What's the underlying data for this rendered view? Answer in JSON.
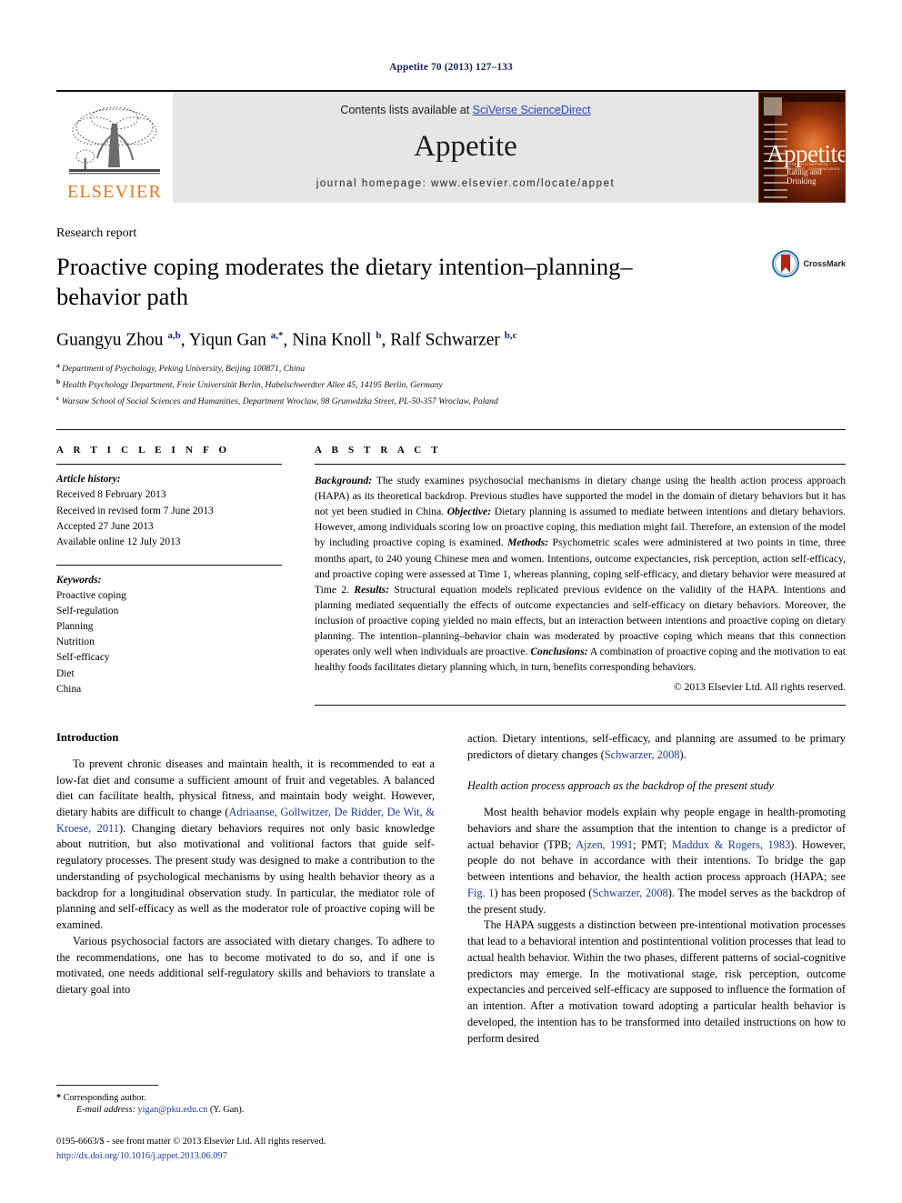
{
  "running_head": "Appetite 70 (2013) 127–133",
  "masthead": {
    "publisher_name": "ELSEVIER",
    "contents_prefix": "Contents lists available at ",
    "contents_link": "SciVerse ScienceDirect",
    "journal_name": "Appetite",
    "homepage_line": "journal homepage: www.elsevier.com/locate/appet",
    "cover": {
      "title": "Appetite",
      "subtitle_small": "RESEARCH REPORTS · REVIEWS · COMMENTARIES",
      "subtitle": "Eating and Drinking"
    },
    "link_color": "#2b46b4",
    "band_color": "#e6e6e6",
    "elsevier_orange": "#e87722"
  },
  "article": {
    "kicker": "Research report",
    "title": "Proactive coping moderates the dietary intention–planning–behavior path",
    "crossmark_label": "CrossMark",
    "authors_html": "Guangyu Zhou <sup>a,b</sup>, Yiqun Gan <sup>a,*</sup>, Nina Knoll <sup>b</sup>, Ralf Schwarzer <sup>b,c</sup>",
    "affiliations": [
      {
        "marker": "a",
        "text": "Department of Psychology, Peking University, Beijing 100871, China"
      },
      {
        "marker": "b",
        "text": "Health Psychology Department, Freie Universität Berlin, Habelschwerdter Allee 45, 14195 Berlin, Germany"
      },
      {
        "marker": "c",
        "text": "Warsaw School of Social Sciences and Humanities, Department Wroclaw, 98 Grunwdzka Street, PL-50-357 Wroclaw, Poland"
      }
    ]
  },
  "article_info": {
    "heading": "A R T I C L E   I N F O",
    "history_label": "Article history:",
    "history": [
      "Received 8 February 2013",
      "Received in revised form 7 June 2013",
      "Accepted 27 June 2013",
      "Available online 12 July 2013"
    ],
    "keywords_label": "Keywords:",
    "keywords": [
      "Proactive coping",
      "Self-regulation",
      "Planning",
      "Nutrition",
      "Self-efficacy",
      "Diet",
      "China"
    ]
  },
  "abstract": {
    "heading": "A B S T R A C T",
    "html": "<em>Background:</em> The study examines psychosocial mechanisms in dietary change using the health action process approach (HAPA) as its theoretical backdrop. Previous studies have supported the model in the domain of dietary behaviors but it has not yet been studied in China. <em>Objective:</em> Dietary planning is assumed to mediate between intentions and dietary behaviors. However, among individuals scoring low on proactive coping, this mediation might fail. Therefore, an extension of the model by including proactive coping is examined. <em>Methods:</em> Psychometric scales were administered at two points in time, three months apart, to 240 young Chinese men and women. Intentions, outcome expectancies, risk perception, action self-efficacy, and proactive coping were assessed at Time 1, whereas planning, coping self-efficacy, and dietary behavior were measured at Time 2. <em>Results:</em> Structural equation models replicated previous evidence on the validity of the HAPA. Intentions and planning mediated sequentially the effects of outcome expectancies and self-efficacy on dietary behaviors. Moreover, the inclusion of proactive coping yielded no main effects, but an interaction between intentions and proactive coping on dietary planning. The intention–planning–behavior chain was moderated by proactive coping which means that this connection operates only well when individuals are proactive. <em>Conclusions:</em> A combination of proactive coping and the motivation to eat healthy foods facilitates dietary planning which, in turn, benefits corresponding behaviors.",
    "copyright": "© 2013 Elsevier Ltd. All rights reserved."
  },
  "body": {
    "left_column": {
      "heading": "Introduction",
      "paragraphs_html": [
        "To prevent chronic diseases and maintain health, it is recommended to eat a low-fat diet and consume a sufficient amount of fruit and vegetables. A balanced diet can facilitate health, physical fitness, and maintain body weight. However, dietary habits are difficult to change (<span class=\"ref\">Adriaanse, Gollwitzer, De Ridder, De Wit, &amp; Kroese, 2011</span>). Changing dietary behaviors requires not only basic knowledge about nutrition, but also motivational and volitional factors that guide self-regulatory processes. The present study was designed to make a contribution to the understanding of psychological mechanisms by using health behavior theory as a backdrop for a longitudinal observation study. In particular, the mediator role of planning and self-efficacy as well as the moderator role of proactive coping will be examined.",
        "Various psychosocial factors are associated with dietary changes. To adhere to the recommendations, one has to become motivated to do so, and if one is motivated, one needs additional self-regulatory skills and behaviors to translate a dietary goal into"
      ]
    },
    "right_column": {
      "paragraph_continuation_html": "action. Dietary intentions, self-efficacy, and planning are assumed to be primary predictors of dietary changes (<span class=\"ref\">Schwarzer, 2008</span>).",
      "subheading": "Health action process approach as the backdrop of the present study",
      "paragraphs_html": [
        "Most health behavior models explain why people engage in health-promoting behaviors and share the assumption that the intention to change is a predictor of actual behavior (TPB; <span class=\"ref\">Ajzen, 1991</span>; PMT; <span class=\"ref\">Maddux &amp; Rogers, 1983</span>). However, people do not behave in accordance with their intentions. To bridge the gap between intentions and behavior, the health action process approach (HAPA; see <span class=\"ref\">Fig. 1</span>) has been proposed (<span class=\"ref\">Schwarzer, 2008</span>). The model serves as the backdrop of the present study.",
        "The HAPA suggests a distinction between pre-intentional motivation processes that lead to a behavioral intention and postintentional volition processes that lead to actual health behavior. Within the two phases, different patterns of social-cognitive predictors may emerge. In the motivational stage, risk perception, outcome expectancies and perceived self-efficacy are supposed to influence the formation of an intention. After a motivation toward adopting a particular health behavior is developed, the intention has to be transformed into detailed instructions on how to perform desired"
      ]
    }
  },
  "footnotes": {
    "corresponding_author": "Corresponding author.",
    "email_label": "E-mail address:",
    "email": "yigan@pku.edu.cn",
    "email_owner": "(Y. Gan).",
    "issn_line": "0195-6663/$ - see front matter © 2013 Elsevier Ltd. All rights reserved.",
    "doi_line": "http://dx.doi.org/10.1016/j.appet.2013.06.097"
  }
}
